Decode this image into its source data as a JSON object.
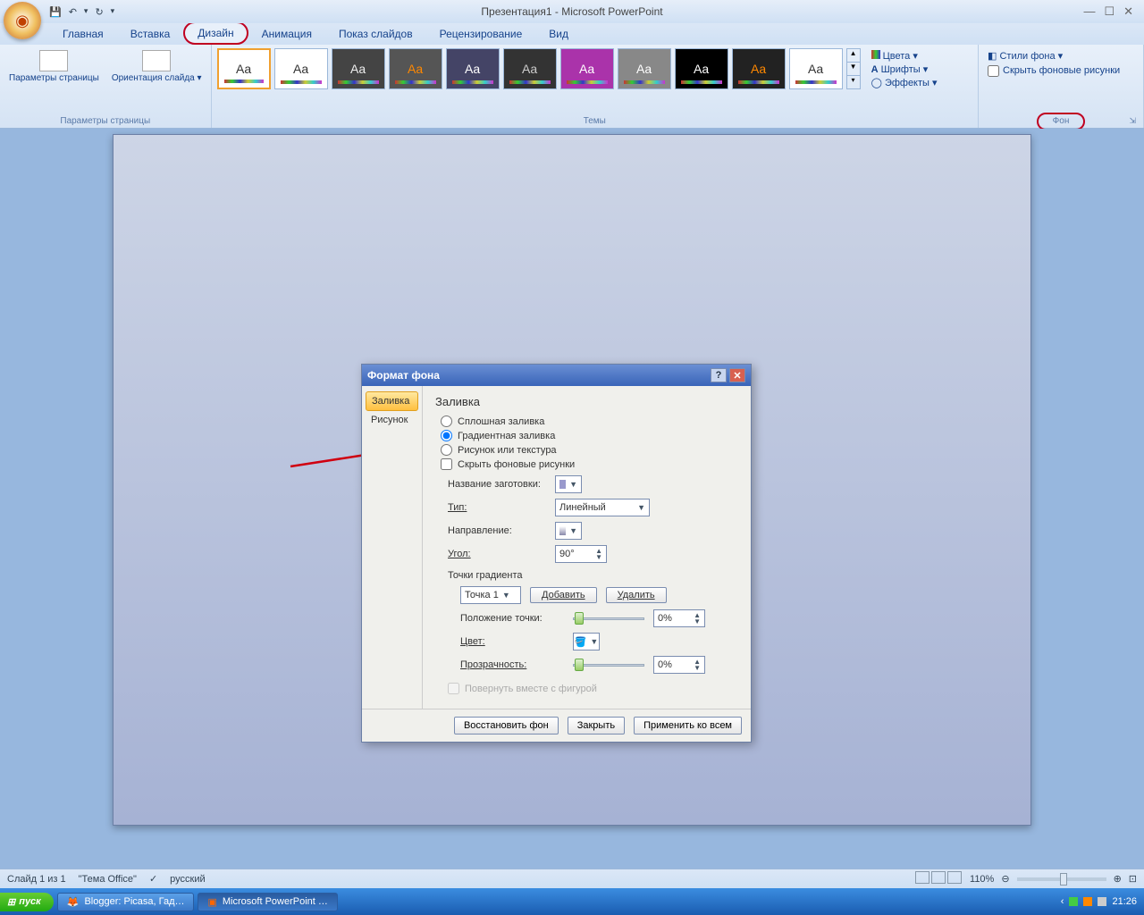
{
  "title": "Презентация1 - Microsoft PowerPoint",
  "qat": {
    "save": "💾",
    "undo": "↶",
    "redo": "↻"
  },
  "tabs": [
    "Главная",
    "Вставка",
    "Дизайн",
    "Анимация",
    "Показ слайдов",
    "Рецензирование",
    "Вид"
  ],
  "active_tab": "Дизайн",
  "ribbon": {
    "page_group": {
      "params": "Параметры страницы",
      "orient": "Ориентация слайда",
      "title": "Параметры страницы"
    },
    "themes_title": "Темы",
    "theme_opts": {
      "colors": "Цвета",
      "fonts": "Шрифты",
      "effects": "Эффекты"
    },
    "bg_group": {
      "styles": "Стили фона",
      "hide": "Скрыть фоновые рисунки",
      "title": "Фон"
    }
  },
  "dialog": {
    "title": "Формат фона",
    "nav": {
      "fill": "Заливка",
      "pic": "Рисунок"
    },
    "heading": "Заливка",
    "r_solid": "Сплошная заливка",
    "r_gradient": "Градиентная заливка",
    "r_picture": "Рисунок или текстура",
    "chk_hide": "Скрыть фоновые рисунки",
    "preset": "Название заготовки:",
    "type_lbl": "Тип:",
    "type_val": "Линейный",
    "direction": "Направление:",
    "angle_lbl": "Угол:",
    "angle_val": "90°",
    "stops_lbl": "Точки градиента",
    "stop_val": "Точка 1",
    "add": "Добавить",
    "del": "Удалить",
    "pos_lbl": "Положение точки:",
    "pos_val": "0%",
    "color_lbl": "Цвет:",
    "trans_lbl": "Прозрачность:",
    "trans_val": "0%",
    "rotate": "Повернуть вместе с фигурой",
    "btn_restore": "Восстановить фон",
    "btn_close": "Закрыть",
    "btn_applyall": "Применить ко всем"
  },
  "status": {
    "slide": "Слайд 1 из 1",
    "theme": "\"Тема Office\"",
    "lang": "русский",
    "zoom": "110%"
  },
  "taskbar": {
    "start": "пуск",
    "items": [
      "Blogger: Picasa, Гад…",
      "Microsoft PowerPoint …"
    ],
    "clock": "21:26"
  }
}
